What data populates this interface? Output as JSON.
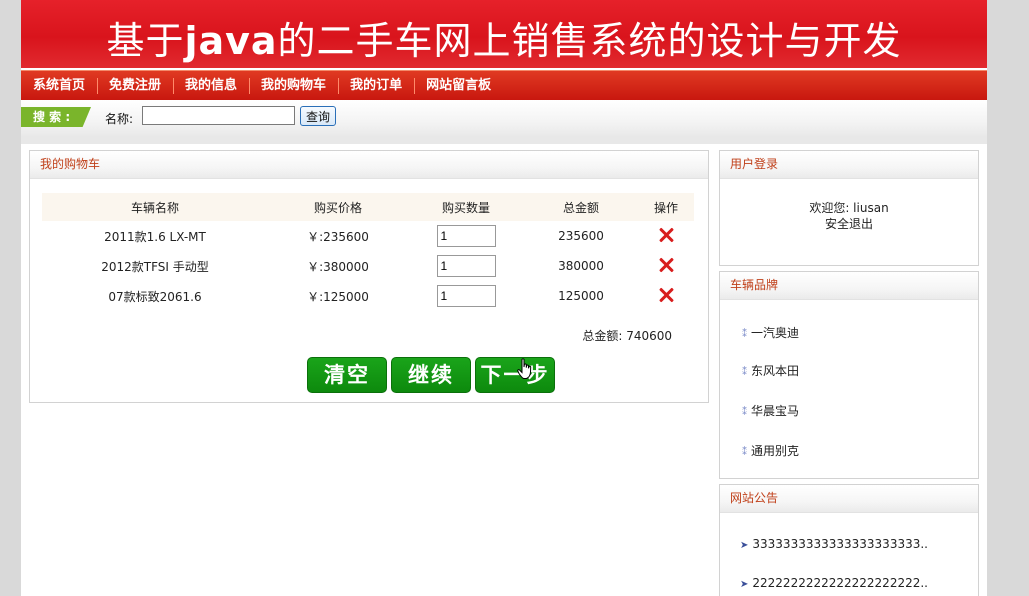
{
  "header": {
    "title_pre": "基于",
    "title_bold": "java",
    "title_post": "的二手车网上销售系统的设计与开发"
  },
  "nav": {
    "items": [
      "系统首页",
      "免费注册",
      "我的信息",
      "我的购物车",
      "我的订单",
      "网站留言板"
    ]
  },
  "search": {
    "tag": "搜 索 :",
    "label": "名称:",
    "value": "",
    "button": "查询"
  },
  "cart": {
    "title": "我的购物车",
    "columns": [
      "车辆名称",
      "购买价格",
      "购买数量",
      "总金额",
      "操作"
    ],
    "rows": [
      {
        "name": "2011款1.6 LX-MT",
        "price": "￥:235600",
        "qty": "1",
        "total": "235600"
      },
      {
        "name": "2012款TFSI 手动型",
        "price": "￥:380000",
        "qty": "1",
        "total": "380000"
      },
      {
        "name": "07款标致2061.6",
        "price": "￥:125000",
        "qty": "1",
        "total": "125000"
      }
    ],
    "total_label": "总金额:",
    "total_value": "740600",
    "buttons": {
      "clear": "清空",
      "continue": "继续",
      "next": "下一步"
    }
  },
  "login": {
    "title": "用户登录",
    "welcome": "欢迎您: liusan",
    "logout": "安全退出"
  },
  "brands": {
    "title": "车辆品牌",
    "items": [
      "一汽奥迪",
      "东风本田",
      "华晨宝马",
      "通用别克"
    ]
  },
  "notices": {
    "title": "网站公告",
    "items": [
      "3333333333333333333333..",
      "2222222222222222222222.."
    ]
  },
  "colors": {
    "banner": "#d9141c",
    "nav": "#c8170f",
    "accent_green": "#0d8a0d",
    "search_tag": "#7ab52b",
    "panel_title": "#c0401a"
  }
}
